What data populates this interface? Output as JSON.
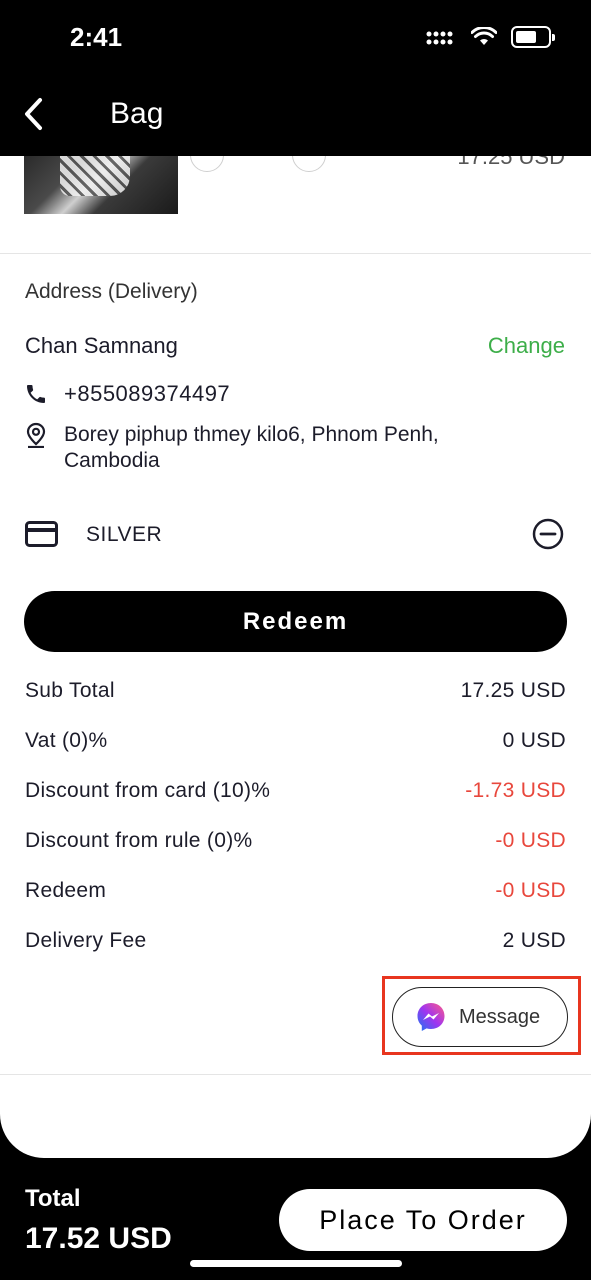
{
  "status_bar": {
    "time": "2:41"
  },
  "header": {
    "title": "Bag"
  },
  "product": {
    "price_partial": "17.25 USD"
  },
  "address": {
    "title": "Address (Delivery)",
    "name": "Chan Samnang",
    "change_label": "Change",
    "phone": "+855089374497",
    "location": "Borey piphup thmey kilo6, Phnom Penh, Cambodia"
  },
  "card": {
    "label": "SILVER"
  },
  "redeem": {
    "label": "Redeem"
  },
  "summary": [
    {
      "label": "Sub Total",
      "value": "17.25 USD",
      "negative": false
    },
    {
      "label": "Vat (0)%",
      "value": "0 USD",
      "negative": false
    },
    {
      "label": "Discount from card (10)%",
      "value": "-1.73 USD",
      "negative": true
    },
    {
      "label": "Discount from rule (0)%",
      "value": "-0 USD",
      "negative": true
    },
    {
      "label": "Redeem",
      "value": "-0 USD",
      "negative": true
    },
    {
      "label": "Delivery Fee",
      "value": "2 USD",
      "negative": false
    }
  ],
  "message": {
    "label": "Message"
  },
  "footer": {
    "total_label": "Total",
    "total_value": "17.52 USD",
    "order_label": "Place To Order"
  },
  "colors": {
    "accent_green": "#3dae49",
    "negative_red": "#e8473c",
    "highlight_red": "#e8351f"
  },
  "icons": [
    "chevron-left-icon",
    "phone-icon",
    "location-pin-icon",
    "credit-card-icon",
    "minus-circle-icon",
    "messenger-icon"
  ]
}
